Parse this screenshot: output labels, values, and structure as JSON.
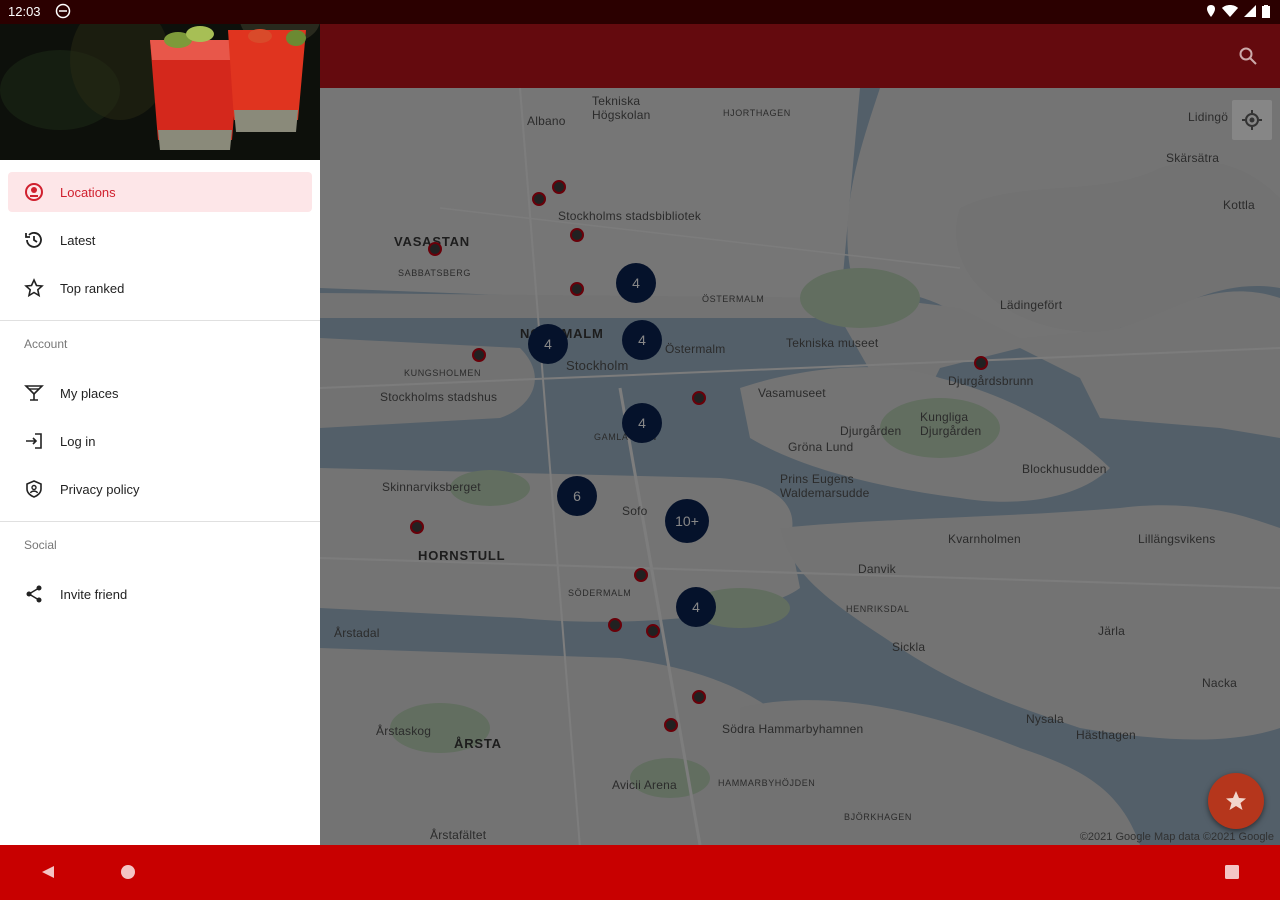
{
  "status_bar": {
    "time": "12:03"
  },
  "drawer": {
    "primary_items": [
      {
        "label": "Locations",
        "icon": "locations-icon",
        "active": true
      },
      {
        "label": "Latest",
        "icon": "history-icon"
      },
      {
        "label": "Top ranked",
        "icon": "star-outline-icon"
      }
    ],
    "account_header": "Account",
    "account_items": [
      {
        "label": "My places",
        "icon": "cocktail-glass-icon"
      },
      {
        "label": "Log in",
        "icon": "login-icon"
      },
      {
        "label": "Privacy policy",
        "icon": "shield-icon"
      }
    ],
    "social_header": "Social",
    "social_items": [
      {
        "label": "Invite friend",
        "icon": "share-icon"
      }
    ]
  },
  "app_bar": {
    "search_icon": "search-icon"
  },
  "map": {
    "labels": {
      "tekniska": "Tekniska\nHögskolan",
      "albano": "Albano",
      "hjorthagen": "HJORTHAGEN",
      "lidingo": "Lidingö",
      "skarsatra": "Skärsätra",
      "kottla": "Kottla",
      "vasastan": "VASASTAN",
      "sabbatsberg": "SABBATSBERG",
      "stadsbibliotek": "Stockholms stadsbibliotek",
      "ostermalm_d": "ÖSTERMALM",
      "norrmalm": "NORRMALM",
      "stockholm": "Stockholm",
      "ostermalm": "Östermalm",
      "tekniska_museet": "Tekniska museet",
      "kungsholmen": "KUNGSHOLMEN",
      "stadshus": "Stockholms stadshus",
      "vasamuseet": "Vasamuseet",
      "djurgardsbrunn": "Djurgårdsbrunn",
      "ladugardsgardet": "Lädingefört",
      "gamla_stan": "GAMLA STAN",
      "djurgarden": "Djurgården",
      "kungliga": "Kungliga\nDjurgården",
      "grona_lund": "Gröna Lund",
      "prins_eugens": "Prins Eugens\nWaldemarsudde",
      "blockhusudden": "Blockhusudden",
      "skinnarviksberget": "Skinnarviksberget",
      "hornstull": "HORNSTULL",
      "sofo": "Sofo",
      "kvarnholmen": "Kvarnholmen",
      "lillangsvikens": "Lillängsvikens",
      "sodermalm": "SÖDERMALM",
      "danvik": "Danvik",
      "henriksdal": "HENRIKSDAL",
      "arstadal": "Årstadal",
      "sickla": "Sickla",
      "jarla": "Järla",
      "nacka": "Nacka",
      "arsta": "ÅRSTA",
      "arstaskog": "Årstaskog",
      "sodra_hammarby": "Södra Hammarbyhamnen",
      "nysala": "Nysala",
      "hastagen": "Hästhagen",
      "hammarbyhojden": "HAMMARBYHÖJDEN",
      "avicii": "Avicii Arena",
      "bjorkhagen": "BJÖRKHAGEN",
      "arstafaltet": "Årstafältet"
    },
    "clusters": [
      {
        "id": "c1",
        "count": "4"
      },
      {
        "id": "c2",
        "count": "4"
      },
      {
        "id": "c3",
        "count": "4"
      },
      {
        "id": "c4",
        "count": "4"
      },
      {
        "id": "c5",
        "count": "6"
      },
      {
        "id": "c6",
        "count": "10+"
      },
      {
        "id": "c7",
        "count": "4"
      }
    ],
    "copyright": "©2021 Google   Map data ©2021 Google",
    "fab_icon": "star-icon",
    "my_location_icon": "my-location-icon"
  },
  "nav_bar": {
    "back_icon": "back-icon",
    "home_icon": "home-icon",
    "recents_icon": "recents-icon"
  },
  "colors": {
    "primary": "#c80000",
    "app_bar": "#640a0e",
    "accent": "#d0202e",
    "cluster": "#0a1f4a"
  }
}
